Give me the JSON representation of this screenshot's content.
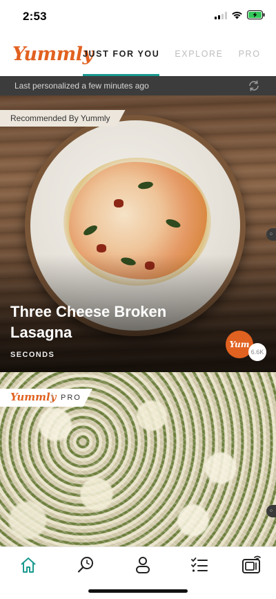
{
  "status_bar": {
    "time": "2:53",
    "battery_color": "#34c759"
  },
  "header": {
    "logo": "Yummly",
    "tabs": [
      {
        "label": "JUST FOR YOU",
        "active": true
      },
      {
        "label": "EXPLORE",
        "active": false
      },
      {
        "label": "PRO",
        "active": false
      }
    ]
  },
  "personalized_bar": {
    "text": "Last personalized a few minutes ago",
    "refresh_icon": "refresh-icon"
  },
  "cards": [
    {
      "badge": "Recommended By Yummly",
      "title": "Three Cheese Broken Lasagna",
      "source": "SECONDS",
      "yum_label": "Yum",
      "yum_count": "6.6K"
    },
    {
      "badge_logo": "Yummly",
      "badge_text": "PRO"
    }
  ],
  "bottom_nav": {
    "items": [
      "home-icon",
      "search-icon",
      "profile-icon",
      "checklist-icon",
      "smart-appliance-icon"
    ],
    "active_color": "#1a9a8f"
  },
  "colors": {
    "brand_orange": "#e16120",
    "accent_teal": "#1a9a8f"
  }
}
